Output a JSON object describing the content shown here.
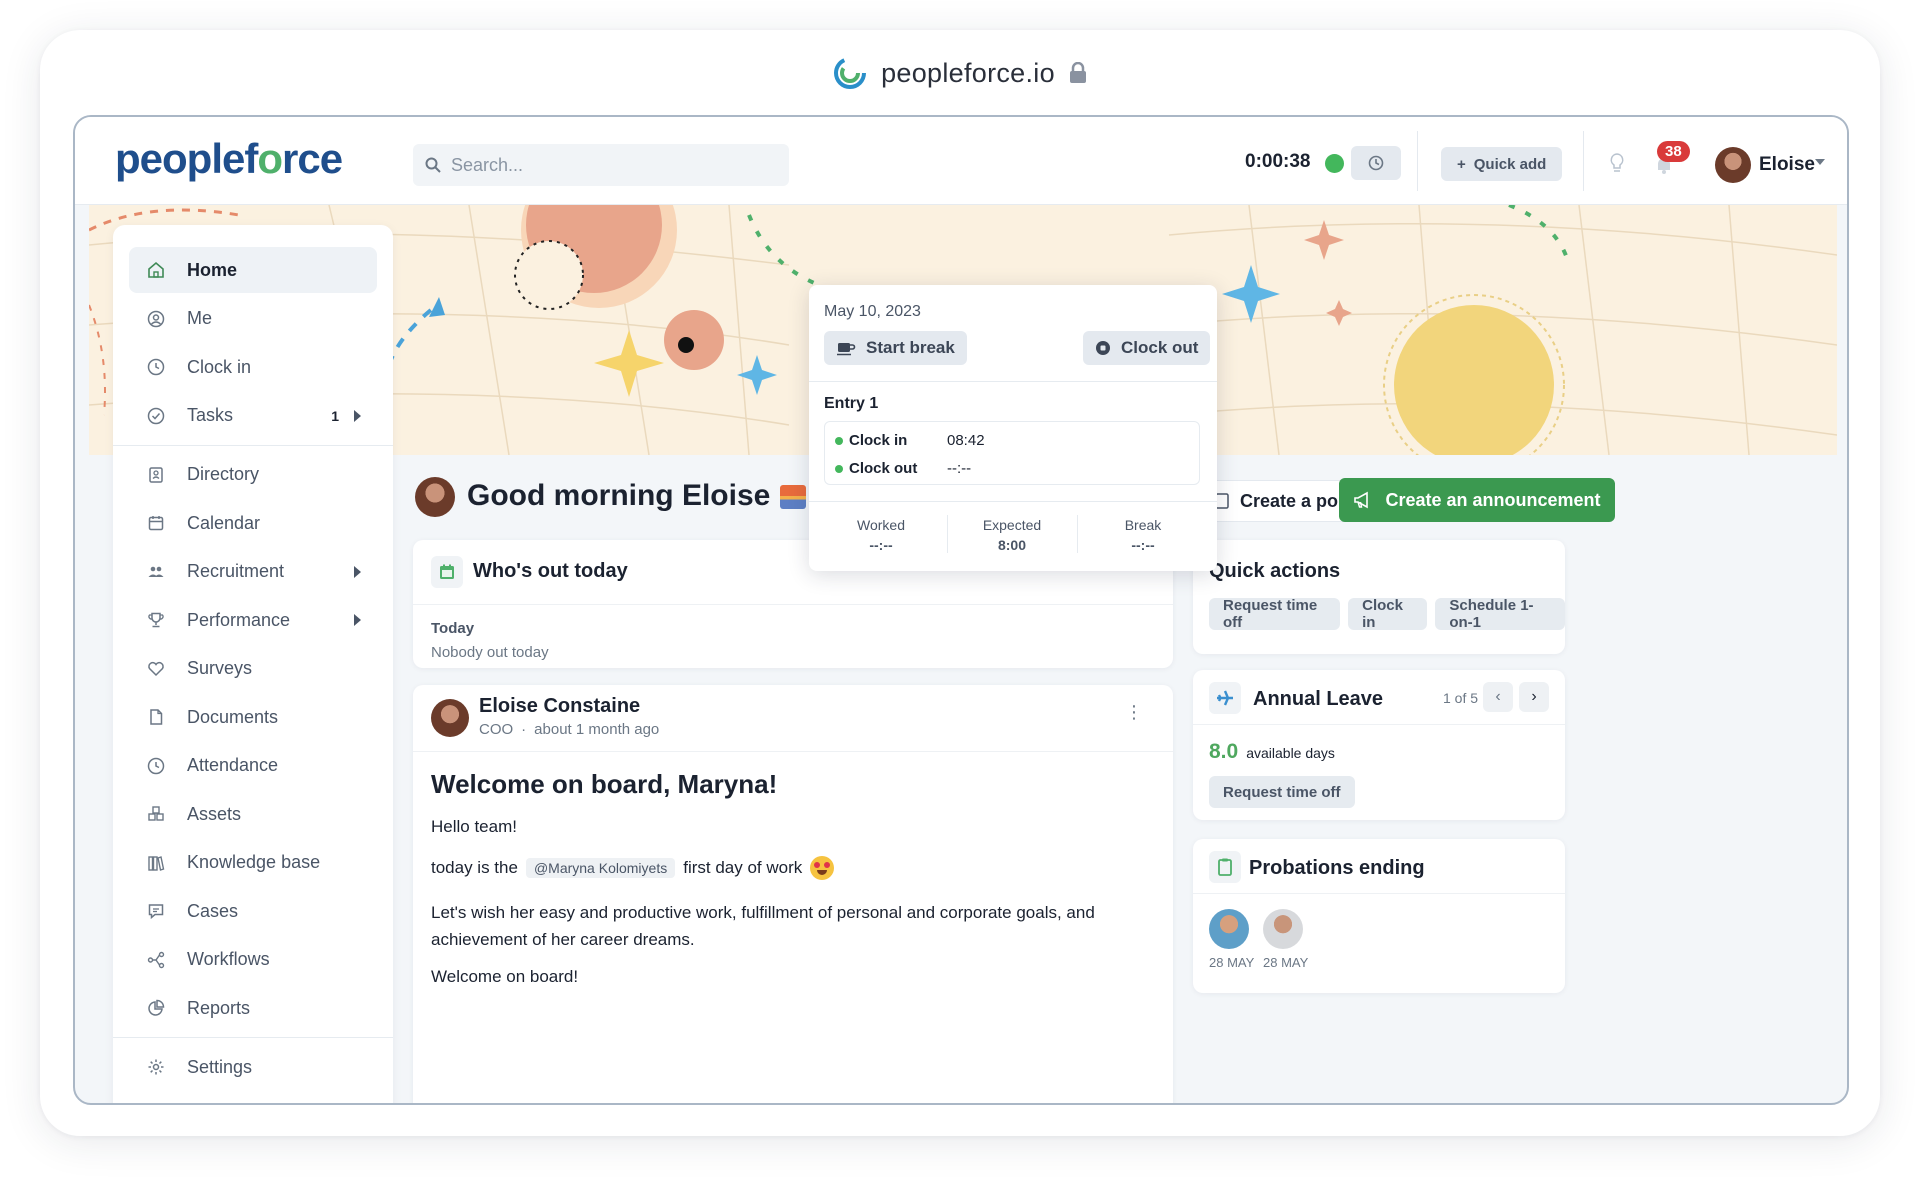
{
  "browser": {
    "url": "peopleforce.io"
  },
  "topbar": {
    "brand": "peoplef",
    "brand_o": "o",
    "brand_rest": "rce",
    "search_placeholder": "Search...",
    "timer": "0:00:38",
    "quick_add": "Quick add",
    "notification_count": "38",
    "user_name": "Eloise"
  },
  "sidebar": {
    "items": [
      {
        "label": "Home",
        "icon": "home-icon"
      },
      {
        "label": "Me",
        "icon": "user-circle-icon"
      },
      {
        "label": "Clock in",
        "icon": "clock-icon"
      },
      {
        "label": "Tasks",
        "icon": "check-circle-icon",
        "count": "1"
      },
      {
        "label": "Directory",
        "icon": "directory-icon"
      },
      {
        "label": "Calendar",
        "icon": "calendar-icon"
      },
      {
        "label": "Recruitment",
        "icon": "people-icon"
      },
      {
        "label": "Performance",
        "icon": "trophy-icon"
      },
      {
        "label": "Surveys",
        "icon": "heart-icon"
      },
      {
        "label": "Documents",
        "icon": "document-icon"
      },
      {
        "label": "Attendance",
        "icon": "clock-icon"
      },
      {
        "label": "Assets",
        "icon": "cubes-icon"
      },
      {
        "label": "Knowledge base",
        "icon": "books-icon"
      },
      {
        "label": "Cases",
        "icon": "chat-icon"
      },
      {
        "label": "Workflows",
        "icon": "workflow-icon"
      },
      {
        "label": "Reports",
        "icon": "pie-chart-icon"
      },
      {
        "label": "Settings",
        "icon": "gear-icon"
      }
    ]
  },
  "greeting": "Good morning Eloise",
  "actions": {
    "poll": "Create a poll",
    "announcement": "Create an announcement"
  },
  "clock_popup": {
    "date": "May 10, 2023",
    "start_break": "Start break",
    "clock_out": "Clock out",
    "entry_title": "Entry 1",
    "clock_in_label": "Clock in",
    "clock_in_value": "08:42",
    "clock_out_label": "Clock out",
    "clock_out_value": "--:--",
    "worked_label": "Worked",
    "worked_value": "--:--",
    "expected_label": "Expected",
    "expected_value": "8:00",
    "break_label": "Break",
    "break_value": "--:--"
  },
  "whos_out": {
    "title": "Who's out today",
    "subtitle": "Today",
    "text": "Nobody out today"
  },
  "post": {
    "author": "Eloise Constaine",
    "role": "COO",
    "time": "about 1 month ago",
    "title": "Welcome on board, Maryna!",
    "line1": "Hello team!",
    "line2_pre": "today is the",
    "mention": "@Maryna Kolomiyets",
    "line2_post": "first day of work",
    "line3": "Let's wish her easy and productive work, fulfillment of personal and corporate goals, and achievement of her career dreams.",
    "line4": "Welcome on board!"
  },
  "quick_actions": {
    "title": "Quick actions",
    "buttons": [
      "Request time off",
      "Clock in",
      "Schedule 1-on-1"
    ]
  },
  "annual_leave": {
    "title": "Annual Leave",
    "pager": "1 of 5",
    "days": "8.0",
    "days_label": "available days",
    "button": "Request time off"
  },
  "probations": {
    "title": "Probations ending",
    "people": [
      {
        "date": "28 MAY"
      },
      {
        "date": "28 MAY"
      }
    ]
  },
  "colors": {
    "accent_green": "#3b9950",
    "brand_blue": "#1f4e8c",
    "badge_red": "#d93a3a"
  }
}
